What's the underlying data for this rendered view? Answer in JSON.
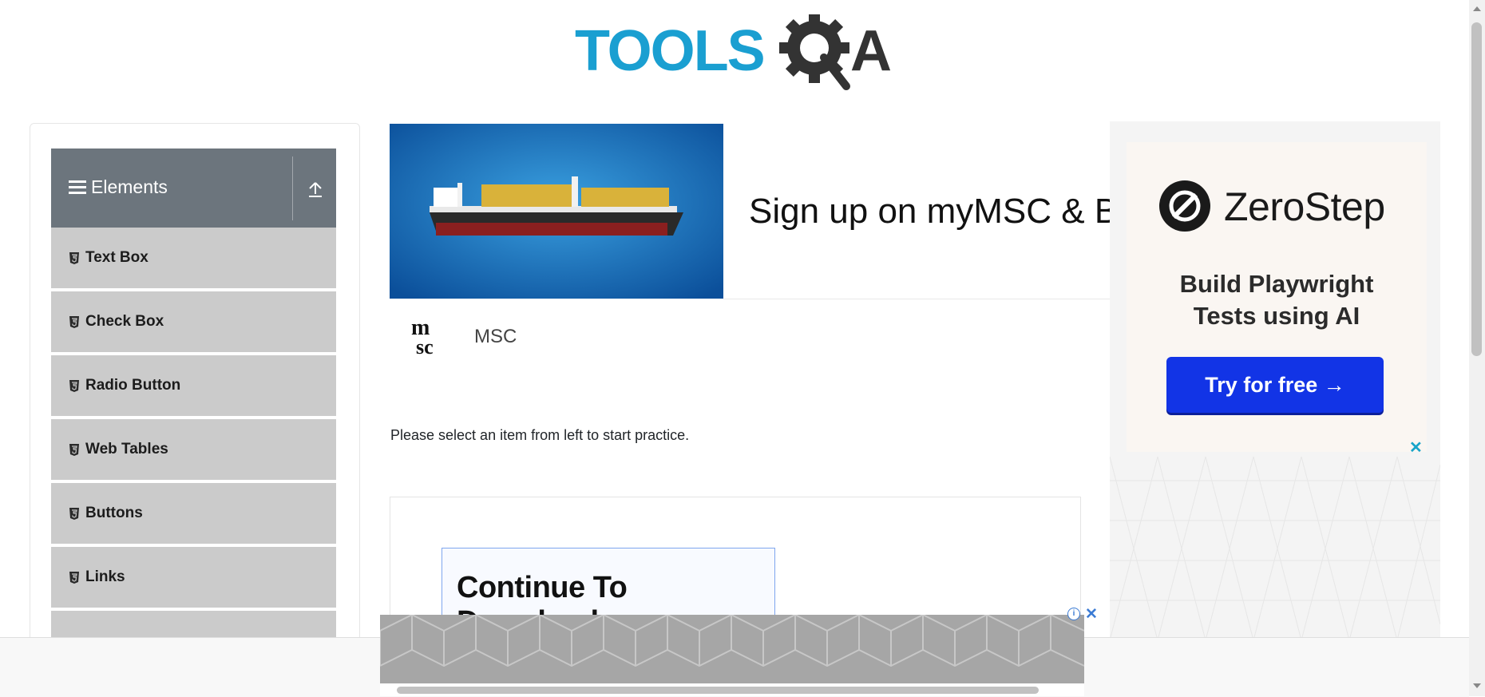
{
  "header": {
    "logo_text": "TOOLSQA"
  },
  "sidebar": {
    "group_title": "Elements",
    "items": [
      {
        "label": "Text Box"
      },
      {
        "label": "Check Box"
      },
      {
        "label": "Radio Button"
      },
      {
        "label": "Web Tables"
      },
      {
        "label": "Buttons"
      },
      {
        "label": "Links"
      },
      {
        "label": ""
      }
    ]
  },
  "main": {
    "ad": {
      "headline": "Sign up on myMSC & B",
      "advertiser": "MSC",
      "logo_text_top": "m",
      "logo_text_bottom": "sc"
    },
    "intro": "Please select an item from left to start practice.",
    "download_button": "Continue To Download"
  },
  "right_ad": {
    "brand": "ZeroStep",
    "tagline_line1": "Build Playwright",
    "tagline_line2": "Tests using AI",
    "cta": "Try for free →",
    "close": "✕"
  },
  "sticky_ad": {
    "info": "i",
    "close": "✕"
  },
  "colors": {
    "accent_blue": "#1a9fd1",
    "sidebar_header": "#6c757d",
    "menu_item_bg": "#cbcbcb",
    "cta_blue": "#1234e6"
  }
}
